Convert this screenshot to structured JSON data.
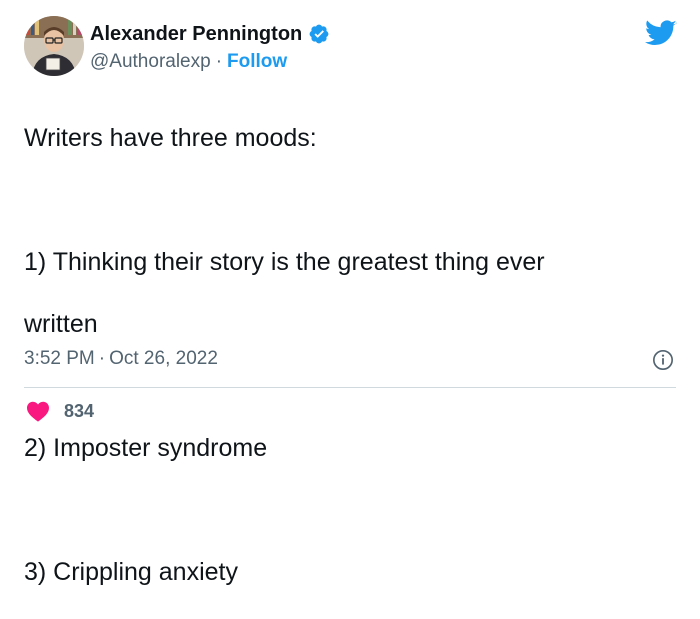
{
  "tweet": {
    "author": {
      "display_name": "Alexander Pennington",
      "handle": "@Authoralexp",
      "verified": true,
      "follow_label": "Follow",
      "separator": "·"
    },
    "text_lines": [
      "Writers have three moods:",
      "",
      "1) Thinking their story is the greatest thing ever",
      "written",
      "",
      "2) Imposter syndrome",
      "",
      "3) Crippling anxiety"
    ],
    "time": "3:52 PM",
    "date": "Oct 26, 2022",
    "likes": "834"
  },
  "icons": {
    "brand": "twitter-bird-icon",
    "verified": "verified-badge-icon",
    "info": "info-icon",
    "like": "heart-icon"
  },
  "colors": {
    "accent": "#1d9bf0",
    "like": "#f91880",
    "text_primary": "#0f1419",
    "text_secondary": "#536471",
    "divider": "#cfd9de"
  }
}
